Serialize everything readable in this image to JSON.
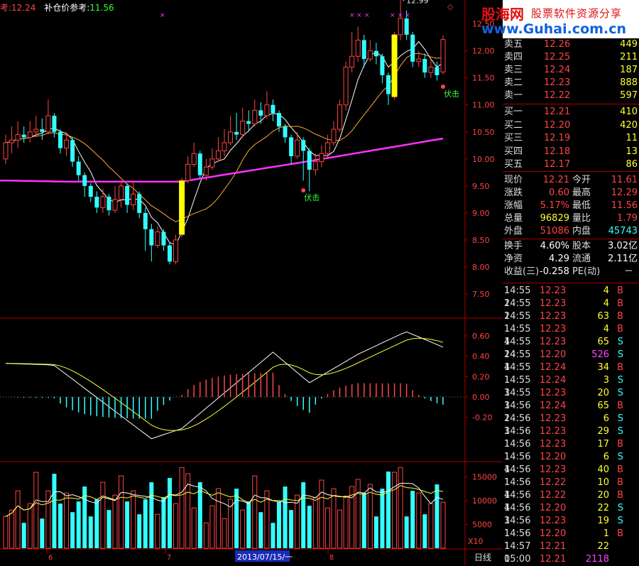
{
  "header": {
    "ref_label": "考:",
    "ref_value": "12.24",
    "add_label": "补仓价参考:",
    "add_value": "11.56"
  },
  "logo": {
    "name": "股海网",
    "slogan": "股票软件资源分享",
    "url": "www.Guhai.com.cn"
  },
  "price_axis": [
    "12.00",
    "11.50",
    "11.00",
    "10.50",
    "10.00",
    "9.50",
    "9.00",
    "8.50",
    "8.00",
    "7.50"
  ],
  "price_axis_top": "12.50",
  "macd_axis": [
    "0.60",
    "0.40",
    "0.20",
    "0.00",
    "-0.20"
  ],
  "vol_axis": [
    "15000",
    "10000",
    "5000"
  ],
  "vol_unit": "X10",
  "high_mark": "12.99",
  "fuji_label": "伏击",
  "date_labels": {
    "d6": "6",
    "d7": "7",
    "dsel": "2013/07/15/一",
    "d8": "8"
  },
  "period": "日线",
  "asks": [
    {
      "label": "卖五",
      "price": "12.26",
      "vol": "449"
    },
    {
      "label": "卖四",
      "price": "12.25",
      "vol": "211"
    },
    {
      "label": "卖三",
      "price": "12.24",
      "vol": "187"
    },
    {
      "label": "卖二",
      "price": "12.23",
      "vol": "888"
    },
    {
      "label": "卖一",
      "price": "12.22",
      "vol": "597"
    }
  ],
  "bids": [
    {
      "label": "买一",
      "price": "12.21",
      "vol": "410"
    },
    {
      "label": "买二",
      "price": "12.20",
      "vol": "420"
    },
    {
      "label": "买三",
      "price": "12.19",
      "vol": "11"
    },
    {
      "label": "买四",
      "price": "12.18",
      "vol": "13"
    },
    {
      "label": "买五",
      "price": "12.17",
      "vol": "86"
    }
  ],
  "quote": [
    {
      "l1": "现价",
      "v1": "12.21",
      "c1": "red",
      "l2": "今开",
      "v2": "11.61",
      "c2": "red"
    },
    {
      "l1": "涨跌",
      "v1": "0.60",
      "c1": "red",
      "l2": "最高",
      "v2": "12.29",
      "c2": "red"
    },
    {
      "l1": "涨幅",
      "v1": "5.17%",
      "c1": "red",
      "l2": "最低",
      "v2": "11.56",
      "c2": "red"
    },
    {
      "l1": "总量",
      "v1": "96829",
      "c1": "yel",
      "l2": "量比",
      "v2": "1.79",
      "c2": "red"
    },
    {
      "l1": "外盘",
      "v1": "51086",
      "c1": "red",
      "l2": "内盘",
      "v2": "45743",
      "c2": "cyan"
    },
    {
      "l1": "换手",
      "v1": "4.60%",
      "c1": "wht",
      "l2": "股本",
      "v2": "3.02亿",
      "c2": "wht"
    },
    {
      "l1": "净资",
      "v1": "4.29",
      "c1": "wht",
      "l2": "流通",
      "v2": "2.11亿",
      "c2": "wht"
    }
  ],
  "eps": {
    "label": "收益(三)",
    "value": "-0.258",
    "pe_label": "PE(动)",
    "pe_value": "－"
  },
  "ticks": [
    {
      "t": "14:55",
      "p": "12.23",
      "v": "4",
      "s": "B",
      "n": "1"
    },
    {
      "t": "14:55",
      "p": "12.23",
      "v": "4",
      "s": "B",
      "n": "2"
    },
    {
      "t": "14:55",
      "p": "12.23",
      "v": "63",
      "s": "B",
      "n": "2"
    },
    {
      "t": "14:55",
      "p": "12.23",
      "v": "4",
      "s": "B",
      "n": "1"
    },
    {
      "t": "14:55",
      "p": "12.23",
      "v": "65",
      "s": "S",
      "n": "4"
    },
    {
      "t": "14:55",
      "p": "12.20",
      "v": "526",
      "s": "S",
      "n": "24"
    },
    {
      "t": "14:55",
      "p": "12.24",
      "v": "34",
      "s": "B",
      "n": "4"
    },
    {
      "t": "14:55",
      "p": "12.24",
      "v": "3",
      "s": "S",
      "n": "1"
    },
    {
      "t": "14:55",
      "p": "12.23",
      "v": "20",
      "s": "S",
      "n": "3"
    },
    {
      "t": "14:56",
      "p": "12.24",
      "v": "65",
      "s": "B",
      "n": "3"
    },
    {
      "t": "14:56",
      "p": "12.23",
      "v": "6",
      "s": "S",
      "n": "2"
    },
    {
      "t": "14:56",
      "p": "12.23",
      "v": "29",
      "s": "S",
      "n": "3"
    },
    {
      "t": "14:56",
      "p": "12.23",
      "v": "17",
      "s": "B",
      "n": "1"
    },
    {
      "t": "14:56",
      "p": "12.20",
      "v": "6",
      "s": "S",
      "n": "1"
    },
    {
      "t": "14:56",
      "p": "12.23",
      "v": "40",
      "s": "B",
      "n": "4"
    },
    {
      "t": "14:56",
      "p": "12.22",
      "v": "10",
      "s": "B",
      "n": "1"
    },
    {
      "t": "14:56",
      "p": "12.22",
      "v": "20",
      "s": "B",
      "n": "4"
    },
    {
      "t": "14:56",
      "p": "12.20",
      "v": "22",
      "s": "S",
      "n": "4"
    },
    {
      "t": "14:56",
      "p": "12.23",
      "v": "19",
      "s": "S",
      "n": "3"
    },
    {
      "t": "14:56",
      "p": "12.20",
      "v": "1",
      "s": "B",
      "n": "1"
    },
    {
      "t": "14:57",
      "p": "12.21",
      "v": "22",
      "s": "",
      "n": "1"
    },
    {
      "t": "15:00",
      "p": "12.21",
      "v": "2118",
      "s": "",
      "n": "0"
    }
  ],
  "chart_data": {
    "type": "candlestick",
    "price_range": [
      7.5,
      12.6
    ],
    "candles": [
      [
        10.0,
        10.3,
        10.45,
        9.9
      ],
      [
        10.3,
        10.35,
        10.6,
        10.1
      ],
      [
        10.35,
        10.45,
        10.7,
        10.2
      ],
      [
        10.45,
        10.4,
        10.6,
        10.3
      ],
      [
        10.4,
        10.5,
        10.7,
        10.3
      ],
      [
        10.5,
        10.55,
        10.8,
        10.4
      ],
      [
        10.55,
        10.5,
        10.75,
        10.35
      ],
      [
        10.5,
        10.8,
        11.1,
        10.45
      ],
      [
        10.8,
        10.5,
        10.85,
        10.4
      ],
      [
        10.5,
        10.2,
        10.55,
        10.1
      ],
      [
        10.2,
        10.35,
        10.5,
        10.05
      ],
      [
        10.35,
        9.95,
        10.4,
        9.85
      ],
      [
        9.95,
        9.7,
        10.05,
        9.6
      ],
      [
        9.7,
        9.5,
        9.75,
        9.3
      ],
      [
        9.5,
        9.3,
        9.55,
        9.2
      ],
      [
        9.3,
        9.1,
        9.4,
        9.0
      ],
      [
        9.1,
        9.3,
        9.45,
        9.0
      ],
      [
        9.3,
        9.05,
        9.35,
        8.95
      ],
      [
        9.05,
        9.25,
        9.5,
        9.0
      ],
      [
        9.25,
        9.5,
        9.6,
        9.1
      ],
      [
        9.5,
        9.15,
        9.55,
        9.0
      ],
      [
        9.15,
        9.35,
        9.6,
        9.05
      ],
      [
        9.35,
        9.0,
        9.4,
        8.9
      ],
      [
        9.0,
        8.7,
        9.1,
        8.3
      ],
      [
        8.7,
        8.4,
        8.8,
        8.1
      ],
      [
        8.4,
        8.65,
        8.75,
        8.35
      ],
      [
        8.65,
        8.4,
        8.7,
        8.3
      ],
      [
        8.4,
        8.1,
        8.45,
        8.05
      ],
      [
        8.1,
        8.5,
        8.6,
        8.05
      ],
      [
        8.6,
        9.6,
        9.65,
        8.55
      ],
      [
        9.6,
        9.9,
        10.05,
        9.55
      ],
      [
        9.9,
        10.1,
        10.3,
        9.85
      ],
      [
        10.1,
        9.7,
        10.15,
        9.65
      ],
      [
        9.7,
        9.85,
        10.0,
        9.6
      ],
      [
        9.85,
        10.0,
        10.2,
        9.8
      ],
      [
        10.0,
        10.15,
        10.4,
        9.95
      ],
      [
        10.15,
        10.3,
        10.55,
        10.05
      ],
      [
        10.3,
        10.5,
        10.8,
        10.25
      ],
      [
        10.5,
        10.45,
        10.85,
        10.35
      ],
      [
        10.45,
        10.7,
        10.95,
        10.4
      ],
      [
        10.7,
        10.65,
        10.9,
        10.5
      ],
      [
        10.65,
        10.9,
        11.1,
        10.6
      ],
      [
        10.9,
        10.8,
        11.05,
        10.65
      ],
      [
        10.8,
        11.0,
        11.25,
        10.75
      ],
      [
        11.0,
        10.85,
        11.1,
        10.7
      ],
      [
        10.85,
        10.6,
        10.9,
        10.5
      ],
      [
        10.6,
        10.4,
        10.65,
        10.3
      ],
      [
        10.4,
        10.05,
        10.45,
        9.9
      ],
      [
        10.05,
        10.35,
        10.5,
        10.0
      ],
      [
        10.35,
        10.15,
        10.4,
        9.6
      ],
      [
        10.15,
        9.8,
        10.2,
        9.4
      ],
      [
        9.8,
        9.95,
        10.1,
        9.7
      ],
      [
        9.95,
        10.1,
        10.25,
        9.85
      ],
      [
        10.1,
        10.3,
        10.45,
        10.0
      ],
      [
        10.3,
        10.55,
        10.7,
        10.25
      ],
      [
        10.55,
        11.0,
        11.1,
        10.5
      ],
      [
        11.0,
        11.7,
        11.8,
        10.9
      ],
      [
        11.7,
        11.9,
        12.35,
        11.6
      ],
      [
        11.9,
        12.2,
        12.45,
        11.8
      ],
      [
        12.2,
        11.85,
        12.3,
        11.7
      ],
      [
        11.85,
        12.0,
        12.2,
        11.8
      ],
      [
        12.0,
        11.9,
        12.15,
        11.75
      ],
      [
        11.9,
        11.55,
        11.95,
        11.4
      ],
      [
        11.55,
        11.2,
        11.6,
        11.0
      ],
      [
        11.15,
        12.3,
        12.35,
        11.1
      ],
      [
        12.3,
        12.6,
        12.99,
        12.2
      ],
      [
        12.6,
        12.3,
        12.75,
        12.2
      ],
      [
        12.3,
        11.8,
        12.35,
        11.7
      ],
      [
        11.8,
        11.85,
        12.0,
        11.7
      ],
      [
        11.85,
        11.6,
        11.95,
        11.5
      ],
      [
        11.6,
        11.7,
        11.85,
        11.5
      ],
      [
        11.7,
        11.55,
        11.8,
        11.45
      ],
      [
        11.61,
        12.21,
        12.29,
        11.56
      ]
    ],
    "signals": [
      29,
      64
    ]
  }
}
